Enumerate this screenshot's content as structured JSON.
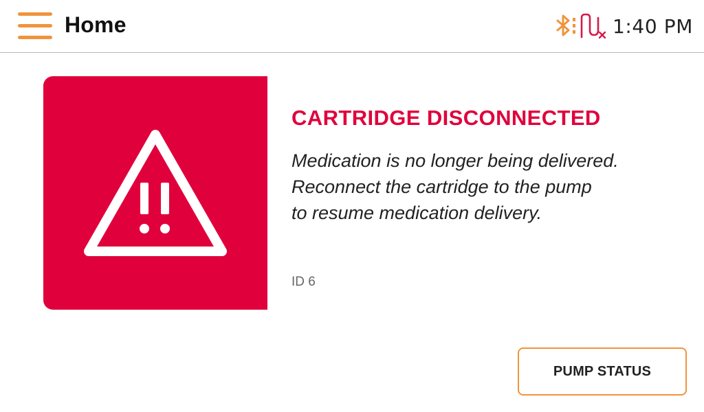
{
  "header": {
    "title": "Home",
    "time": "1:40 PM"
  },
  "alert": {
    "title": "CARTRIDGE DISCONNECTED",
    "message_lines": [
      "Medication is no longer being delivered.",
      "Reconnect the cartridge to the pump",
      "to resume medication delivery."
    ],
    "id_text": "ID 6"
  },
  "actions": {
    "pump_status_label": "PUMP STATUS"
  },
  "icons": {
    "menu": "hamburger-menu-icon",
    "bluetooth": "bluetooth-icon",
    "pump": "pump-disconnected-icon",
    "warning": "warning-icon"
  },
  "colors": {
    "accent": "#f0943c",
    "alert": "#e0003c",
    "pump_icon": "#d41a4a"
  }
}
